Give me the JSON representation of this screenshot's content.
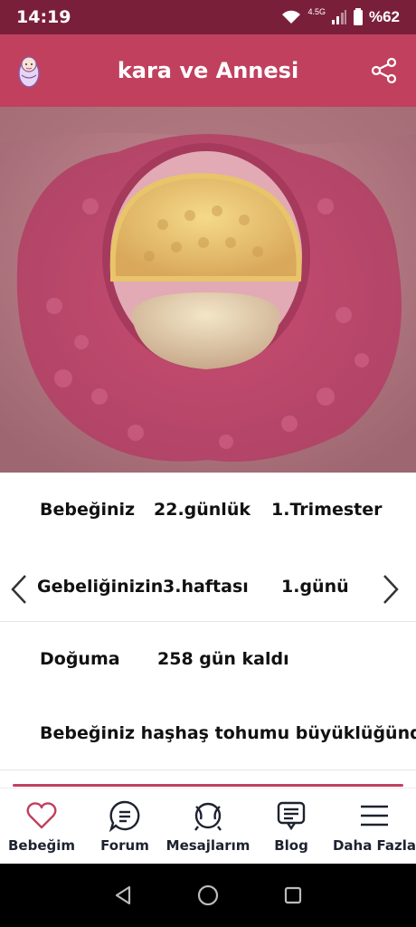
{
  "status": {
    "time": "14:19",
    "network": "4.5G",
    "battery": "%62"
  },
  "header": {
    "title": "kara ve Annesi",
    "left_icon": "baby-icon",
    "right_icon": "share-icon"
  },
  "info": {
    "row1": {
      "label": "Bebeğiniz",
      "days": "22.günlük",
      "trimester": "1.Trimester"
    },
    "row2": {
      "label": "Gebeliğinizin",
      "week": "3.haftası",
      "day": "1.günü"
    },
    "row3": {
      "label": "Doğuma",
      "remaining": "258 gün kaldı"
    },
    "row4": {
      "size_text": "Bebeğiniz haşhaş tohumu büyüklüğünde"
    }
  },
  "tabs": [
    {
      "label": "Bebeğim",
      "icon": "heart-icon"
    },
    {
      "label": "Forum",
      "icon": "forum-icon"
    },
    {
      "label": "Mesajlarım",
      "icon": "messages-icon"
    },
    {
      "label": "Blog",
      "icon": "blog-icon"
    },
    {
      "label": "Daha Fazla",
      "icon": "menu-icon"
    }
  ],
  "colors": {
    "header": "#c1405e",
    "statusbar": "#7a1f3a",
    "accent": "#c1405e"
  }
}
